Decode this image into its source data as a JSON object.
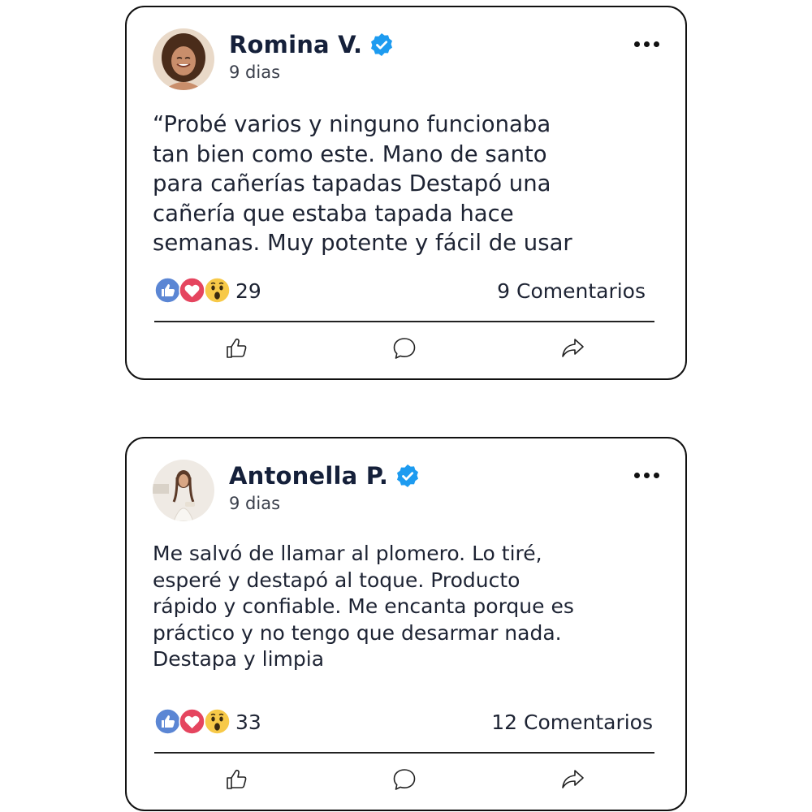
{
  "posts": [
    {
      "author": "Romina V.",
      "verified_icon": "verified-badge-icon",
      "time": "9 dias",
      "text": "“Probé varios y ninguno funcionaba\ntan bien como este. Mano de santo\npara cañerías tapadas Destapó una\ncañería que estaba tapada hace\nsemanas. Muy potente y fácil de usar",
      "reactions": [
        "like-icon",
        "love-icon",
        "wow-icon"
      ],
      "reaction_count": "29",
      "comments": "9 Comentarios",
      "actions": [
        "thumbs-up-icon",
        "comment-bubble-icon",
        "share-arrow-icon"
      ]
    },
    {
      "author": "Antonella P.",
      "verified_icon": "verified-badge-icon",
      "time": "9 dias",
      "text": "Me salvó de llamar al plomero. Lo tiré,\nesperé y destapó al toque. Producto\nrápido y confiable. Me encanta porque es\npráctico y no tengo que desarmar nada.\nDestapa y limpia",
      "reactions": [
        "like-icon",
        "love-icon",
        "wow-icon"
      ],
      "reaction_count": "33",
      "comments": "12 Comentarios",
      "actions": [
        "thumbs-up-icon",
        "comment-bubble-icon",
        "share-arrow-icon"
      ]
    }
  ],
  "colors": {
    "verified": "#1d9bf0",
    "like": "#5b86d4",
    "love": "#e5455f",
    "wow": "#f7c948",
    "text": "#1d2333"
  }
}
